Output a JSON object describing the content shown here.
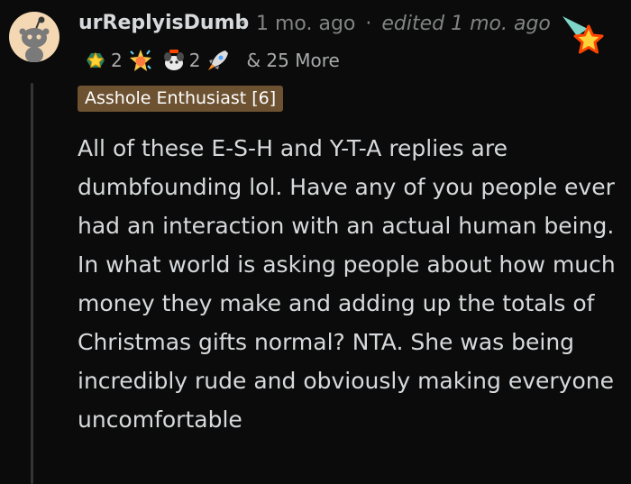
{
  "comment": {
    "username": "urReplyisDumb",
    "separator": "·",
    "timestamp": "1 mo. ago",
    "edited": "edited 1 mo. ago",
    "awards": [
      {
        "icon": "wholesome-seal-icon",
        "count": "2"
      },
      {
        "icon": "starstruck-icon",
        "count": ""
      },
      {
        "icon": "helpful-dog-icon",
        "count": "2"
      },
      {
        "icon": "rocket-icon",
        "count": ""
      }
    ],
    "more_awards": "& 25 More",
    "flair": "Asshole Enthusiast [6]",
    "body": "All of these E-S-H and Y-T-A replies are dumbfounding lol. Have any of you people ever had an interaction with an actual human being. In what world is asking people about how much money they make and adding up the totals of Christmas gifts normal? NTA. She was being incredibly rude and obviously making everyone uncomfortable"
  },
  "colors": {
    "background": "#0b0b0b",
    "flair_bg": "#6d5232",
    "text": "#d7dadc",
    "meta": "#818384"
  }
}
